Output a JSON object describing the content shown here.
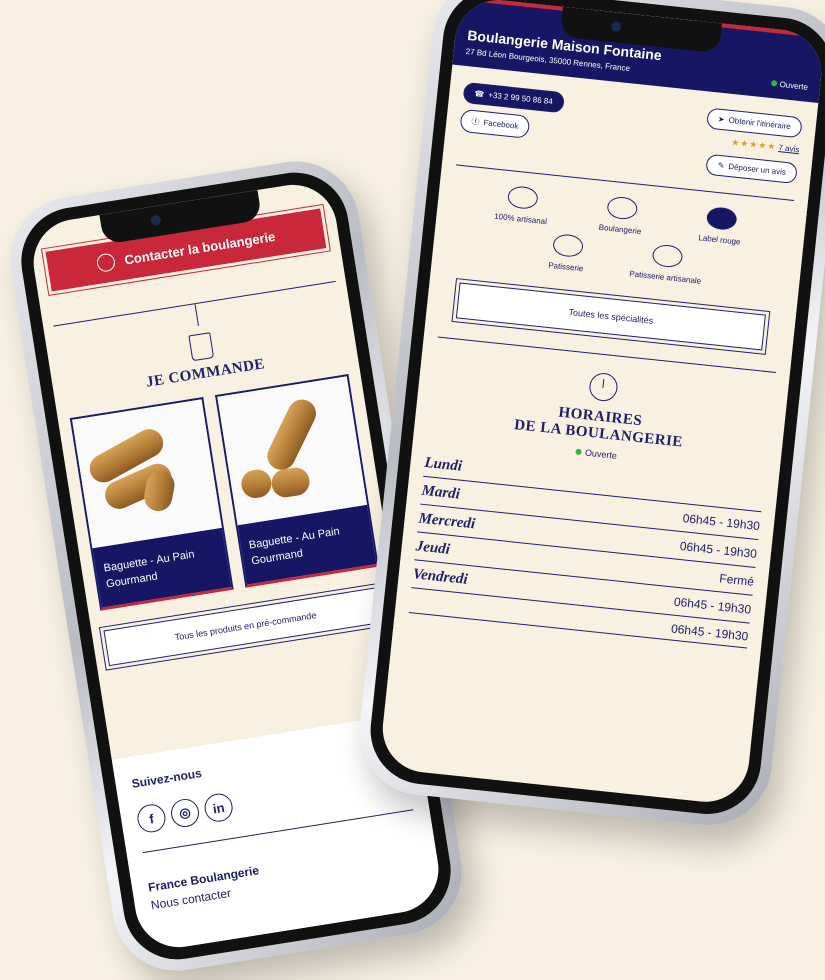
{
  "left_screen": {
    "contact_button": "Contacter la boulangerie",
    "order_section_title": "JE COMMANDE",
    "products": [
      {
        "name": "Baguette - Au Pain Gourmand"
      },
      {
        "name": "Baguette - Au Pain Gourmand"
      }
    ],
    "all_products_button": "Tous les produits en pré-commande",
    "follow_label": "Suivez-nous",
    "social_icons": [
      "facebook-icon",
      "instagram-icon",
      "linkedin-icon"
    ],
    "footer_brand": "France Boulangerie",
    "footer_contact": "Nous contacter"
  },
  "right_screen": {
    "shop_name": "Boulangerie Maison Fontaine",
    "address": "27 Bd Léon Bourgeois, 35000 Rennes, France",
    "status": "Ouverte",
    "phone": "+33 2 99 50 86 84",
    "facebook": "Facebook",
    "itinerary": "Obtenir l'itinéraire",
    "rating_stars": "★★★★★",
    "reviews_link": "7 avis",
    "leave_review": "Déposer un avis",
    "specialties": [
      {
        "label": "100% artisanal"
      },
      {
        "label": "Boulangerie"
      },
      {
        "label": "Label rouge"
      },
      {
        "label": "Patisserie"
      },
      {
        "label": "Patisserie artisanale"
      }
    ],
    "all_specialties_button": "Toutes les spécialités",
    "hours_title_line1": "HORAIRES",
    "hours_title_line2": "DE LA BOULANGERIE",
    "hours_status": "Ouverte",
    "hours": [
      {
        "day": "Lundi",
        "value": ""
      },
      {
        "day": "Mardi",
        "value": "06h45 - 19h30"
      },
      {
        "day": "Mercredi",
        "value": "06h45 - 19h30"
      },
      {
        "day": "Jeudi",
        "value": "Fermé"
      },
      {
        "day": "Vendredi",
        "value": "06h45 - 19h30"
      },
      {
        "day": "",
        "value": "06h45 - 19h30"
      }
    ]
  },
  "colors": {
    "navy": "#161664",
    "red": "#c8283a",
    "cream": "#f8f0e0",
    "green": "#2fb344"
  }
}
